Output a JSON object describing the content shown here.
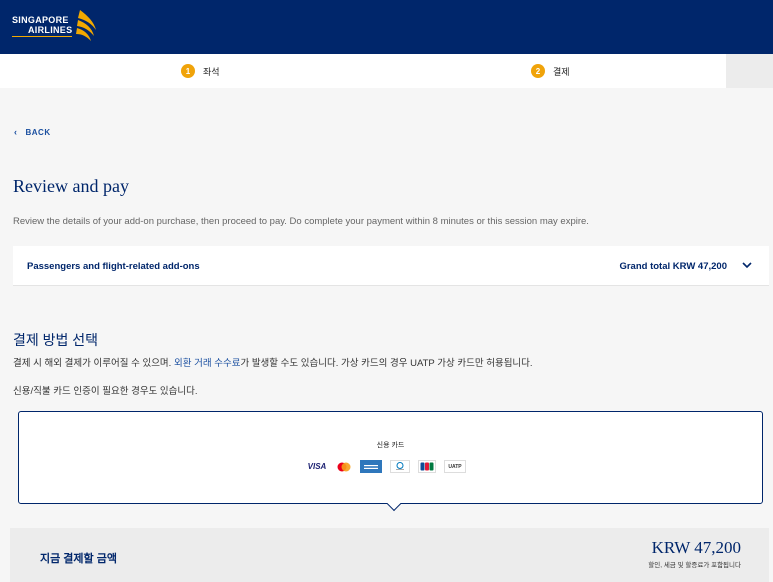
{
  "header": {
    "logo_line1": "SINGAPORE",
    "logo_line2": "AIRLINES",
    "brand_color": "#00266b",
    "accent_color": "#f2a900"
  },
  "steps": [
    {
      "num": "1",
      "label": "좌석"
    },
    {
      "num": "2",
      "label": "결제"
    }
  ],
  "back": {
    "icon": "chevron-left-icon",
    "label": "BACK"
  },
  "page": {
    "title": "Review and pay",
    "subtitle": "Review the details of your add-on purchase, then proceed to pay. Do complete your payment within 8 minutes or this session may expire."
  },
  "summary": {
    "left": "Passengers and flight-related add-ons",
    "right": "Grand total KRW 47,200",
    "icon": "chevron-down-icon"
  },
  "payment_method": {
    "title": "결제 방법 선택",
    "text1_before": "결제 시 해외 결제가 이루어질 수 있으며. ",
    "text1_link": "외환 거래 수수료",
    "text1_after": "가 발생할 수도 있습니다. 가상 카드의 경우 UATP 가상 카드만 허용됩니다.",
    "text2": "신용/직불 카드 인증이 필요한 경우도 있습니다.",
    "option_label": "신용 카드",
    "card_logos": [
      "VISA",
      "mastercard",
      "AMEX",
      "Diners",
      "JCB",
      "UATP"
    ]
  },
  "pay_now": {
    "label": "지금 결제할 금액",
    "amount": "KRW 47,200",
    "note": "할인, 세금 및 할증료가 포함됩니다"
  }
}
